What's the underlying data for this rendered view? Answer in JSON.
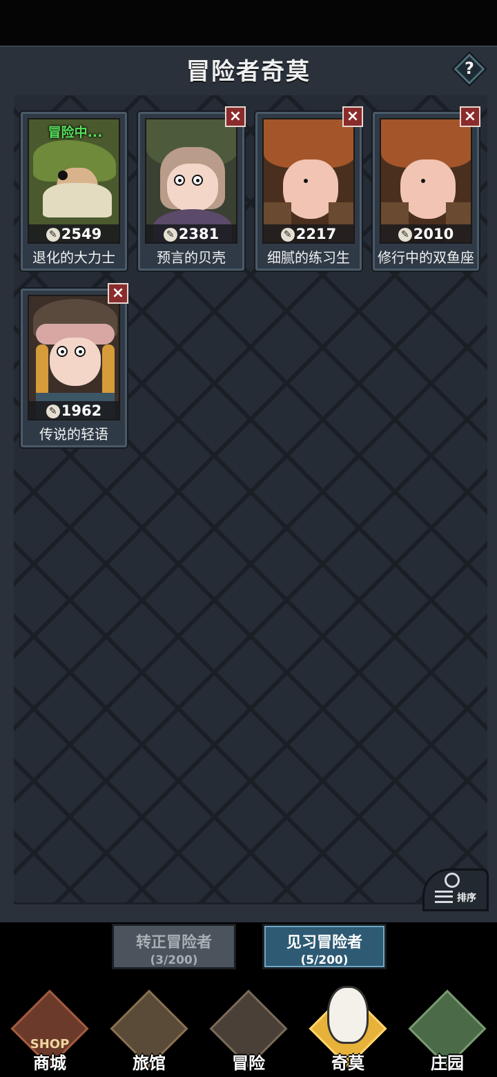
{
  "header": {
    "title": "冒险者奇莫",
    "help_label": "?"
  },
  "cards": [
    {
      "name": "退化的大力士",
      "power": "2549",
      "status": "冒险中...",
      "has_close": false
    },
    {
      "name": "预言的贝壳",
      "power": "2381",
      "status": "",
      "has_close": true
    },
    {
      "name": "细腻的练习生",
      "power": "2217",
      "status": "",
      "has_close": true
    },
    {
      "name": "修行中的双鱼座",
      "power": "2010",
      "status": "",
      "has_close": true
    },
    {
      "name": "传说的轻语",
      "power": "1962",
      "status": "",
      "has_close": true
    }
  ],
  "sort": {
    "label": "排序"
  },
  "tabs": [
    {
      "title": "转正冒险者",
      "count": "(3/200)",
      "active": false
    },
    {
      "title": "见习冒险者",
      "count": "(5/200)",
      "active": true
    }
  ],
  "nav": [
    {
      "label": "商城",
      "icon": "shop-icon",
      "sign": "SHOP"
    },
    {
      "label": "旅馆",
      "icon": "inn-icon"
    },
    {
      "label": "冒险",
      "icon": "crossed-swords-icon"
    },
    {
      "label": "奇莫",
      "icon": "kimo-mascot-icon",
      "selected": true
    },
    {
      "label": "庄园",
      "icon": "manor-island-icon"
    }
  ]
}
